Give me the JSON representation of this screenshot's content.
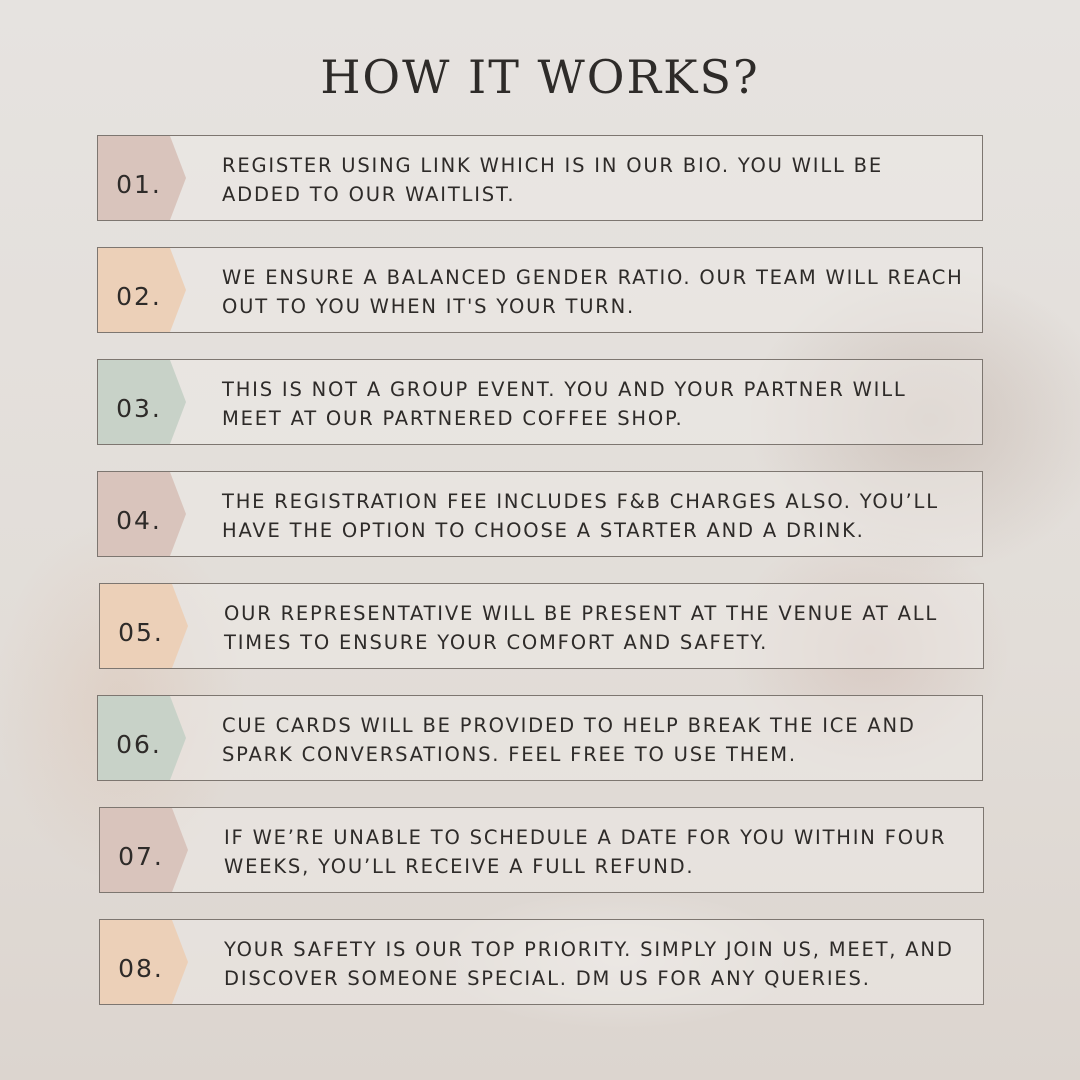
{
  "title": "HOW IT WORKS?",
  "steps": [
    {
      "number": "01.",
      "color": "#d9c4bc",
      "text": "REGISTER USING LINK WHICH IS IN OUR BIO. YOU WILL BE ADDED TO OUR WAITLIST."
    },
    {
      "number": "02.",
      "color": "#ecd0b8",
      "text": "WE ENSURE A BALANCED GENDER RATIO. OUR TEAM WILL REACH OUT TO YOU WHEN IT'S YOUR TURN."
    },
    {
      "number": "03.",
      "color": "#c8d2c8",
      "text": "THIS IS NOT A GROUP EVENT. YOU AND YOUR PARTNER WILL MEET AT OUR PARTNERED COFFEE SHOP."
    },
    {
      "number": "04.",
      "color": "#d9c4bc",
      "text": "THE REGISTRATION FEE INCLUDES F&B CHARGES ALSO. YOU’LL HAVE THE OPTION TO CHOOSE A STARTER AND A DRINK."
    },
    {
      "number": "05.",
      "color": "#ecd0b8",
      "text": "OUR REPRESENTATIVE WILL BE PRESENT AT THE VENUE AT ALL TIMES TO ENSURE YOUR COMFORT AND SAFETY."
    },
    {
      "number": "06.",
      "color": "#c8d2c8",
      "text": "CUE CARDS WILL BE PROVIDED TO HELP BREAK THE ICE AND SPARK CONVERSATIONS. FEEL FREE TO USE THEM."
    },
    {
      "number": "07.",
      "color": "#d9c4bc",
      "text": "IF WE’RE UNABLE TO SCHEDULE A DATE FOR YOU WITHIN FOUR WEEKS, YOU’LL RECEIVE A FULL REFUND."
    },
    {
      "number": "08.",
      "color": "#ecd0b8",
      "text": "YOUR SAFETY IS OUR TOP PRIORITY. SIMPLY JOIN US, MEET, AND DISCOVER SOMEONE SPECIAL. DM US FOR ANY QUERIES."
    }
  ]
}
